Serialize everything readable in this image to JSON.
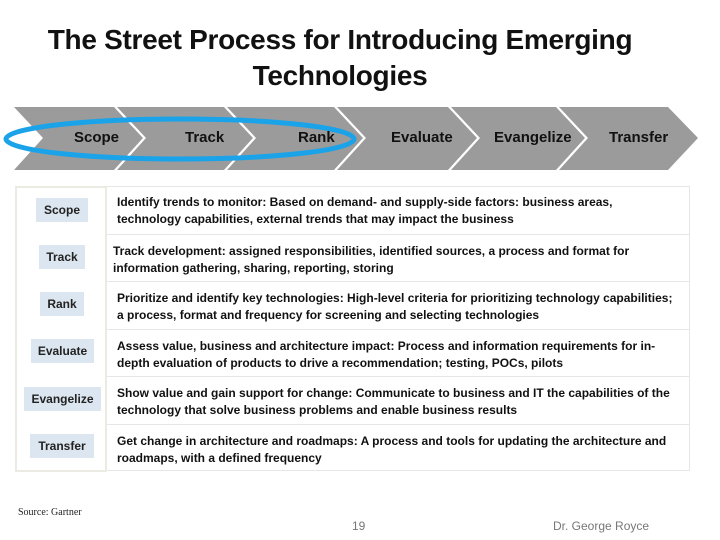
{
  "title": "The Street Process for Introducing Emerging Technologies",
  "process_steps": [
    {
      "label": "Scope"
    },
    {
      "label": "Track"
    },
    {
      "label": "Rank"
    },
    {
      "label": "Evaluate"
    },
    {
      "label": "Evangelize"
    },
    {
      "label": "Transfer"
    }
  ],
  "highlight": {
    "covers_steps": [
      "Scope",
      "Track",
      "Rank"
    ],
    "color": "#1aa3e8"
  },
  "colors": {
    "chevron_fill": "#9b9b9b",
    "tag_fill": "#dce6f0"
  },
  "details": [
    {
      "step": "Scope",
      "description": "Identify trends to monitor: Based on demand- and supply-side factors: business areas, technology capabilities, external trends that may impact the business"
    },
    {
      "step": "Track",
      "description": "Track development: assigned responsibilities, identified sources, a process and format for information gathering, sharing, reporting, storing"
    },
    {
      "step": "Rank",
      "description": "Prioritize and identify key technologies: High-level criteria for prioritizing technology capabilities; a process, format and frequency for screening and selecting technologies"
    },
    {
      "step": "Evaluate",
      "description": "Assess value, business and architecture impact: Process and information requirements for in-depth evaluation of products to drive a recommendation; testing, POCs, pilots"
    },
    {
      "step": "Evangelize",
      "description": "Show value and gain support for change: Communicate to business and IT the capabilities of the technology that solve business problems and enable business results"
    },
    {
      "step": "Transfer",
      "description": "Get change in architecture and roadmaps: A process and tools for updating the architecture and roadmaps, with a defined frequency"
    }
  ],
  "footer": {
    "source": "Source: Gartner",
    "page_number": "19",
    "author": "Dr. George Royce"
  }
}
